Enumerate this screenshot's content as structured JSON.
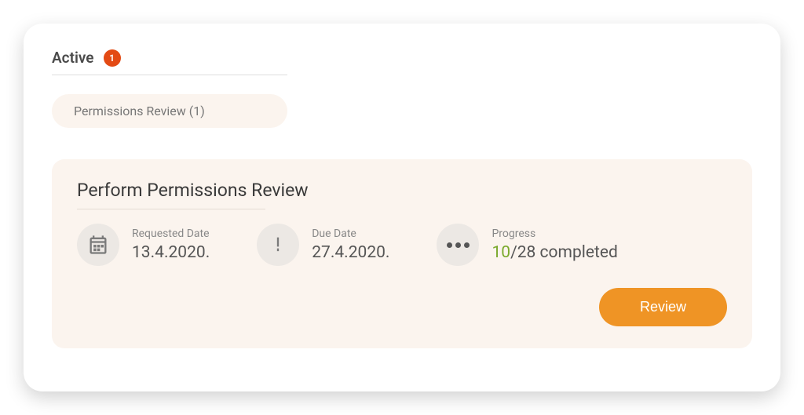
{
  "tab": {
    "label": "Active",
    "badge_count": "1"
  },
  "filter": {
    "label": "Permissions Review (1)"
  },
  "task": {
    "title": "Perform Permissions Review",
    "requested": {
      "label": "Requested Date",
      "value": "13.4.2020."
    },
    "due": {
      "label": "Due Date",
      "value": "27.4.2020."
    },
    "progress": {
      "label": "Progress",
      "done": "10",
      "total_suffix": "/28 completed"
    },
    "review_button": "Review"
  },
  "colors": {
    "accent_orange": "#ef9425",
    "badge_red": "#e34a14",
    "progress_green": "#7aa92b",
    "panel_bg": "#fbf4ee"
  }
}
